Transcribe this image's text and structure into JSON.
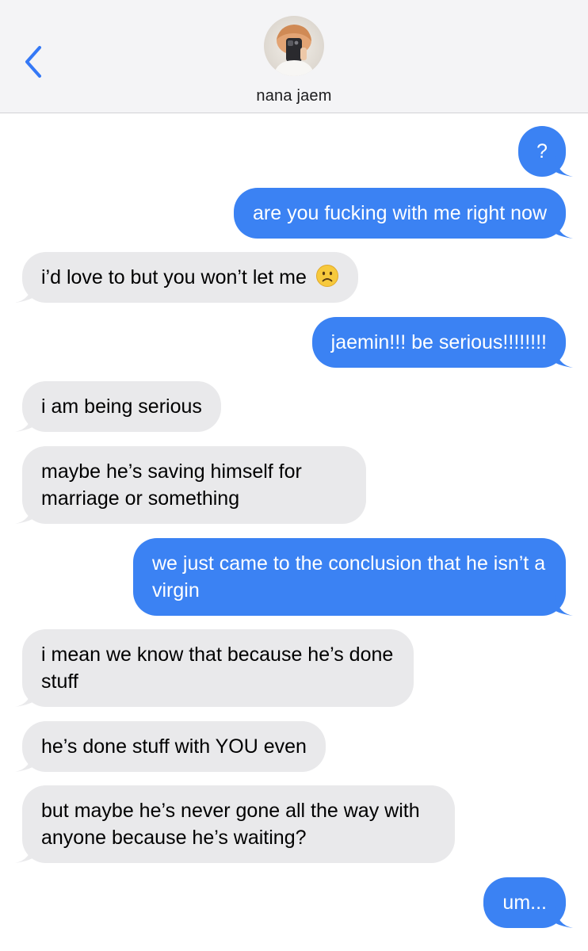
{
  "header": {
    "contact_name": "nana jaem",
    "back_icon": "chevron-left-icon",
    "accent_color": "#3478f6"
  },
  "colors": {
    "outgoing_bubble": "#3b82f3",
    "incoming_bubble": "#e9e9eb",
    "outgoing_text": "#ffffff",
    "incoming_text": "#000000"
  },
  "messages": [
    {
      "direction": "out",
      "text": "?"
    },
    {
      "direction": "out",
      "text": "are you fucking with me right now"
    },
    {
      "direction": "in",
      "text": "i’d love to but you won’t let me",
      "emoji": "frowning-face-emoji"
    },
    {
      "direction": "out",
      "text": "jaemin!!! be serious!!!!!!!!"
    },
    {
      "direction": "in",
      "text": "i am being serious"
    },
    {
      "direction": "in",
      "text": "maybe he’s saving himself for marriage or something"
    },
    {
      "direction": "out",
      "text": "we just came to the conclusion that he isn’t a virgin"
    },
    {
      "direction": "in",
      "text": "i mean we know that because he’s done stuff"
    },
    {
      "direction": "in",
      "text": "he’s done stuff with YOU even"
    },
    {
      "direction": "in",
      "text": "but maybe he’s never gone all the way with anyone because he’s waiting?"
    },
    {
      "direction": "out",
      "text": "um..."
    }
  ]
}
